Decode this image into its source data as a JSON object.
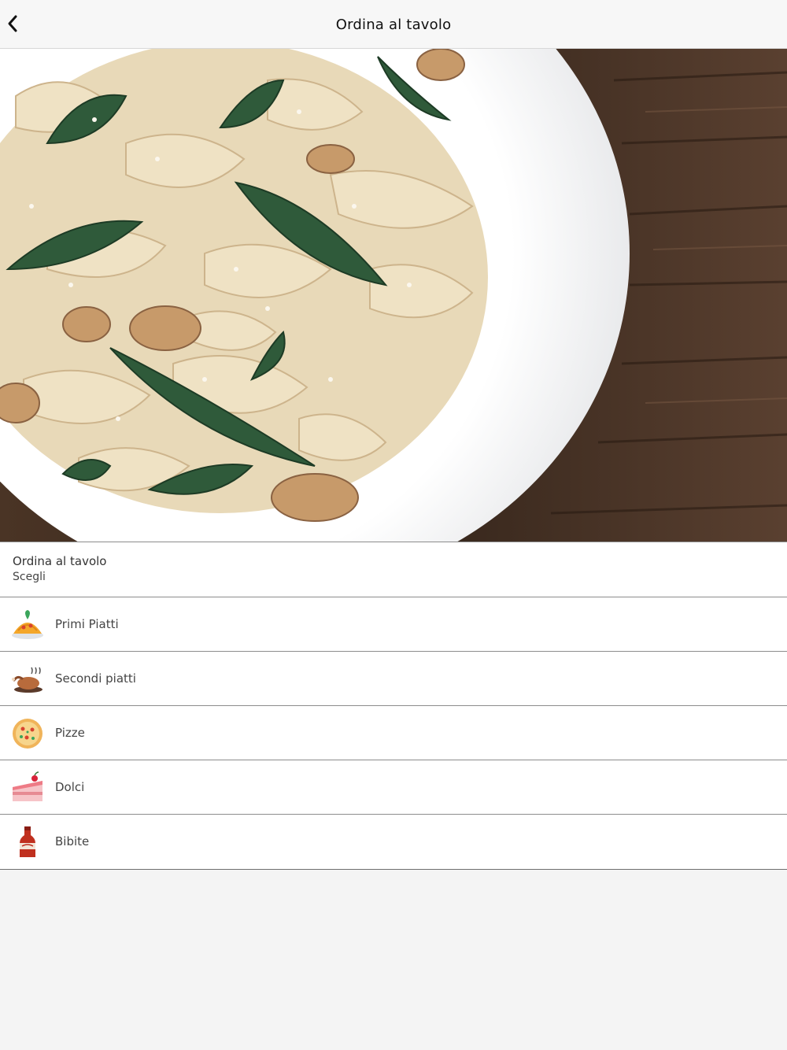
{
  "navbar": {
    "title": "Ordina al tavolo",
    "back_icon": "chevron-left-icon"
  },
  "hero": {
    "image": "pasta-dish-photo"
  },
  "info": {
    "title": "Ordina al tavolo",
    "subtitle": "Scegli"
  },
  "menu": {
    "items": [
      {
        "label": "Primi Piatti",
        "icon": "spaghetti-icon"
      },
      {
        "label": "Secondi piatti",
        "icon": "roast-chicken-icon"
      },
      {
        "label": "Pizze",
        "icon": "pizza-icon"
      },
      {
        "label": "Dolci",
        "icon": "cake-slice-icon"
      },
      {
        "label": "Bibite",
        "icon": "soda-bottle-icon"
      }
    ]
  },
  "colors": {
    "background": "#f4f4f4",
    "divider": "#8c8c8c"
  }
}
